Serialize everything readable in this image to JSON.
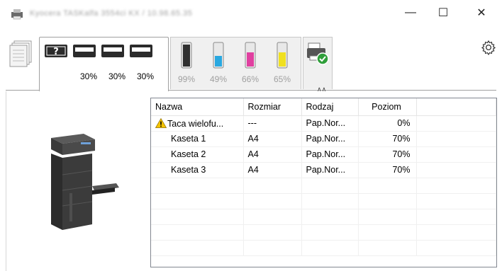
{
  "window": {
    "title": "Kyocera TASKalfa 3554ci KX / 10.98.65.35",
    "minimize": "—",
    "maximize": "☐",
    "close": "✕"
  },
  "trays": {
    "unknown_label": "?",
    "levels": [
      "30%",
      "30%",
      "30%"
    ]
  },
  "toner": {
    "levels": [
      "99%",
      "49%",
      "66%",
      "65%"
    ],
    "colors": [
      "#303030",
      "#29a8e0",
      "#e040a0",
      "#f0e020"
    ]
  },
  "collapse_icon": "chevron-up-icon",
  "table": {
    "columns": [
      "Nazwa",
      "Rozmiar",
      "Rodzaj",
      "Poziom"
    ],
    "rows": [
      {
        "name": "Taca wielofu...",
        "size": "---",
        "type": "Pap.Nor...",
        "level": "0%",
        "warning": true
      },
      {
        "name": "Kaseta 1",
        "size": "A4",
        "type": "Pap.Nor...",
        "level": "70%",
        "warning": false
      },
      {
        "name": "Kaseta 2",
        "size": "A4",
        "type": "Pap.Nor...",
        "level": "70%",
        "warning": false
      },
      {
        "name": "Kaseta 3",
        "size": "A4",
        "type": "Pap.Nor...",
        "level": "70%",
        "warning": false
      }
    ]
  }
}
